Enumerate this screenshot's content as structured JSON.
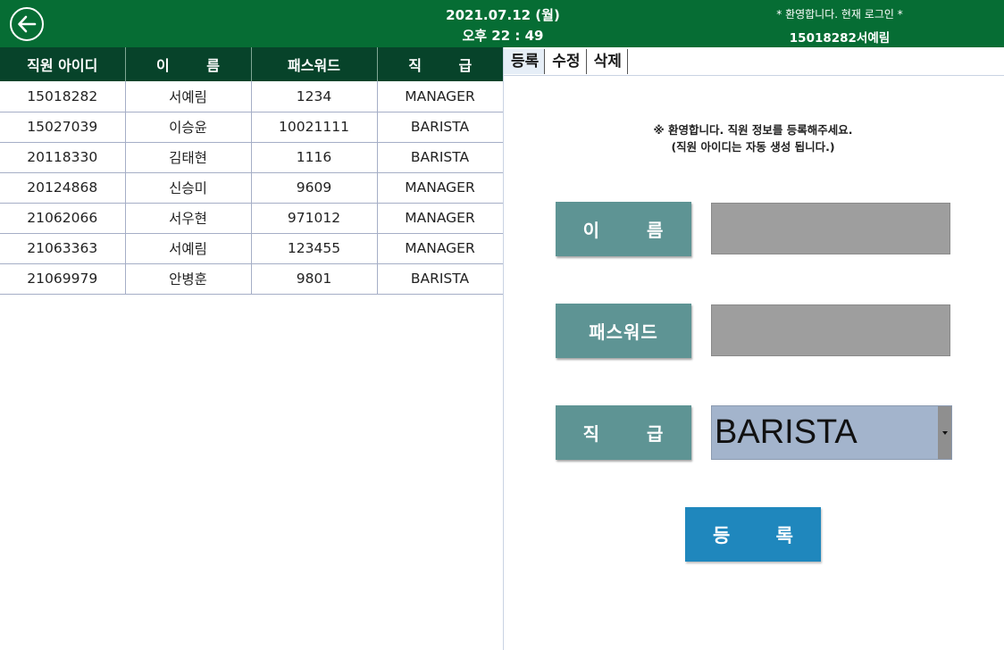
{
  "header": {
    "date": "2021.07.12 (월)",
    "time": "오후 22 : 49",
    "welcome": "* 환영합니다. 현재 로그인 *",
    "current_user": "15018282서예림",
    "back_icon": "arrow-left-circle-icon",
    "background_color": "#066d34"
  },
  "table": {
    "columns": [
      "직원 아이디",
      "이 름",
      "패스워드",
      "직 급"
    ],
    "rows": [
      [
        "15018282",
        "서예림",
        "1234",
        "MANAGER"
      ],
      [
        "15027039",
        "이승윤",
        "10021111",
        "BARISTA"
      ],
      [
        "20118330",
        "김태현",
        "1116",
        "BARISTA"
      ],
      [
        "20124868",
        "신승미",
        "9609",
        "MANAGER"
      ],
      [
        "21062066",
        "서우현",
        "971012",
        "MANAGER"
      ],
      [
        "21063363",
        "서예림",
        "123455",
        "MANAGER"
      ],
      [
        "21069979",
        "안병훈",
        "9801",
        "BARISTA"
      ]
    ]
  },
  "tabs": [
    {
      "label": "등록",
      "active": true
    },
    {
      "label": "수정",
      "active": false
    },
    {
      "label": "삭제",
      "active": false
    }
  ],
  "form": {
    "notice_line1": "※ 환영합니다. 직원 정보를 등록해주세요.",
    "notice_line2": "(직원 아이디는 자동 생성 됩니다.)",
    "name_label": "이 름",
    "password_label": "패스워드",
    "rank_label": "직 급",
    "name_value": "",
    "password_value": "",
    "rank_selected": "BARISTA",
    "submit_label": "등 록",
    "label_color": "#5e9494",
    "submit_color": "#1f87bd"
  }
}
